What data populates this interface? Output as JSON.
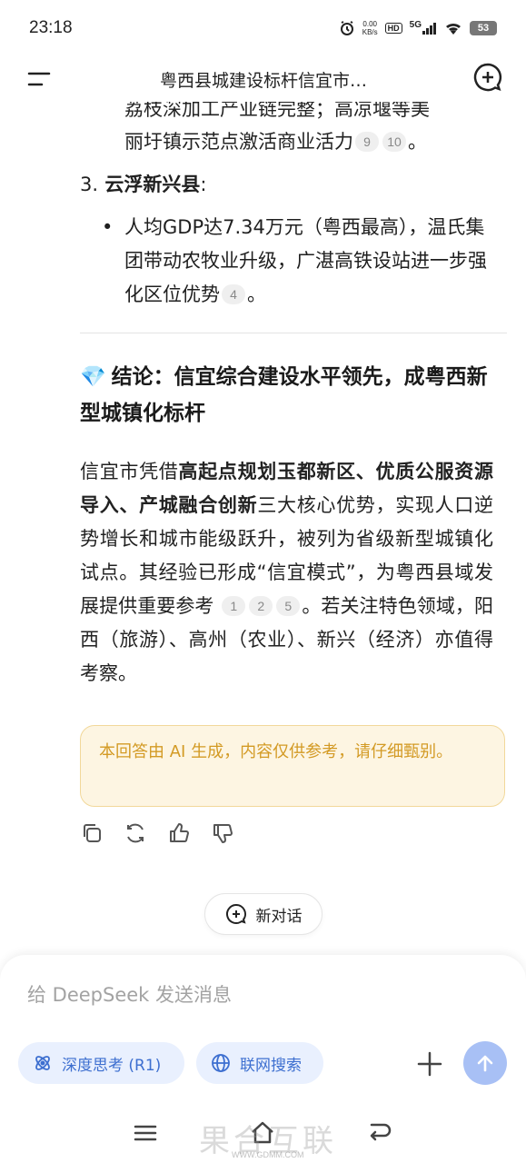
{
  "status_bar": {
    "time": "23:18",
    "net_speed_value": "0.00",
    "net_speed_unit": "KB/s",
    "hd": "HD",
    "network": "5G",
    "battery": "53"
  },
  "header": {
    "title": "粤西县城建设标杆信宜市…"
  },
  "previous_item_tail": {
    "line1": "荔枝深加工产业链完整；高凉堰等美",
    "line2": "丽圩镇示范点激活商业活力",
    "citations": [
      "9",
      "10"
    ],
    "end": "。"
  },
  "list_item_3": {
    "number": "3.",
    "title": "云浮新兴县",
    "colon": ":"
  },
  "bullet": {
    "dot": "•",
    "text": "人均GDP达7.34万元（粤西最高），温氏集团带动农牧业升级，广湛高铁设站进一步强化区位优势",
    "citation": "4",
    "end": "。"
  },
  "conclusion": {
    "emoji": "💎",
    "heading": "结论：信宜综合建设水平领先，成粤西新型城镇化标杆",
    "body_prefix": "信宜市凭借",
    "body_bold": "高起点规划玉都新区、优质公服资源导入、产城融合创新",
    "body_mid": "三大核心优势，实现人口逆势增长和城市能级跃升，被列为省级新型城镇化试点。其经验已形成“信宜模式”，为粤西县域发展提供重要参考",
    "citations": [
      "1",
      "2",
      "5"
    ],
    "body_suffix": "。若关注特色领域，阳西（旅游）、高州（农业）、新兴（经济）亦值得考察。"
  },
  "ai_notice": "本回答由 AI 生成，内容仅供参考，请仔细甄别。",
  "new_chat_label": "新对话",
  "composer": {
    "placeholder": "给 DeepSeek 发送消息",
    "deep_think_label": "深度思考 (R1)",
    "web_search_label": "联网搜索"
  },
  "watermark": {
    "text": "果合互联",
    "url": "WWW.GDMM.COM"
  },
  "colors": {
    "accent": "#3d6fd0",
    "chip_bg": "#e9f0fe",
    "send_bg": "#a8c0f5",
    "notice_bg": "#fdf5e2",
    "notice_text": "#d39a24"
  }
}
